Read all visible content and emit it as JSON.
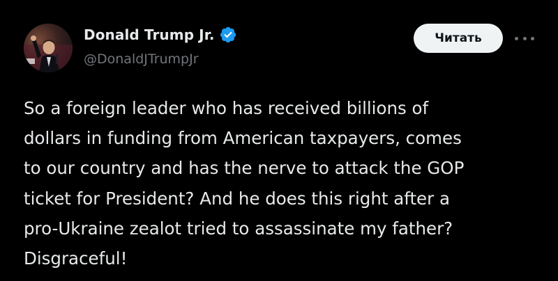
{
  "tweet": {
    "author": {
      "display_name": "Donald Trump Jr.",
      "handle": "@DonaldJTrumpJr",
      "verified": true,
      "avatar": "profile-photo"
    },
    "actions": {
      "read_label": "Читать",
      "more_icon": "more-horizontal-icon"
    },
    "text_lines": [
      "So a foreign leader who has received billions of",
      "dollars in funding from American taxpayers, comes",
      "to our country and has the nerve to attack the GOP",
      "ticket for President? And he does this right after a",
      "pro-Ukraine zealot tried to assassinate my father?",
      "Disgraceful!"
    ]
  },
  "colors": {
    "background": "#000000",
    "text": "#e7e9ea",
    "secondary_text": "#71767b",
    "verified_blue": "#1d9bf0",
    "button_bg": "#eff3f4",
    "button_text": "#0f1419"
  }
}
